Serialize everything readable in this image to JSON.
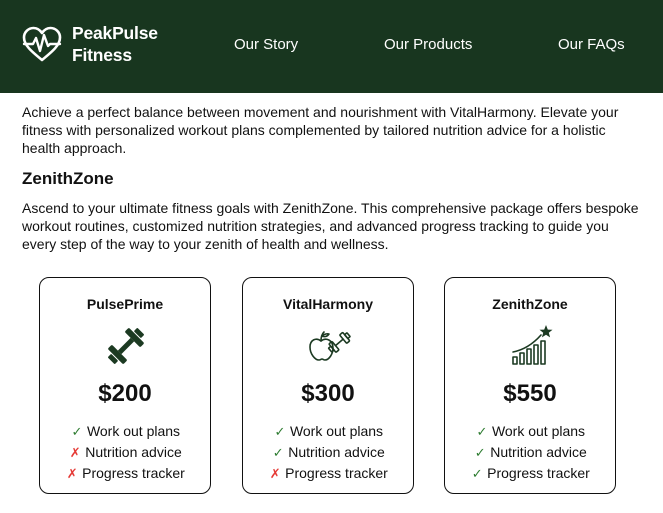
{
  "brand": {
    "line1": "PeakPulse",
    "line2": "Fitness"
  },
  "nav": {
    "items": [
      {
        "label": "Our Story"
      },
      {
        "label": "Our Products"
      },
      {
        "label": "Our FAQs"
      }
    ]
  },
  "content": {
    "intro": "Achieve a perfect balance between movement and nourishment with VitalHarmony. Elevate your fitness with personalized workout plans complemented by tailored nutrition advice for a holistic health approach.",
    "section_title": "ZenithZone",
    "section_text": "Ascend to your ultimate fitness goals with ZenithZone. This comprehensive package offers bespoke workout routines, customized nutrition strategies, and advanced progress tracking to guide you every step of the way to your zenith of health and wellness."
  },
  "colors": {
    "header_bg": "#18361f",
    "icon_color": "#1c3a22",
    "check": "#2f7d32",
    "cross": "#e53935"
  },
  "plans": [
    {
      "name": "PulsePrime",
      "price": "$200",
      "icon": "dumbbell-icon",
      "features": [
        {
          "mark": "✓",
          "label": "Work out plans",
          "included": true
        },
        {
          "mark": "✗",
          "label": "Nutrition advice",
          "included": false
        },
        {
          "mark": "✗",
          "label": "Progress tracker",
          "included": false
        }
      ]
    },
    {
      "name": "VitalHarmony",
      "price": "$300",
      "icon": "apple-dumbbell-icon",
      "features": [
        {
          "mark": "✓",
          "label": "Work out plans",
          "included": true
        },
        {
          "mark": "✓",
          "label": "Nutrition advice",
          "included": true
        },
        {
          "mark": "✗",
          "label": "Progress tracker",
          "included": false
        }
      ]
    },
    {
      "name": "ZenithZone",
      "price": "$550",
      "icon": "growth-chart-star-icon",
      "features": [
        {
          "mark": "✓",
          "label": "Work out plans",
          "included": true
        },
        {
          "mark": "✓",
          "label": "Nutrition advice",
          "included": true
        },
        {
          "mark": "✓",
          "label": "Progress tracker",
          "included": true
        }
      ]
    }
  ]
}
